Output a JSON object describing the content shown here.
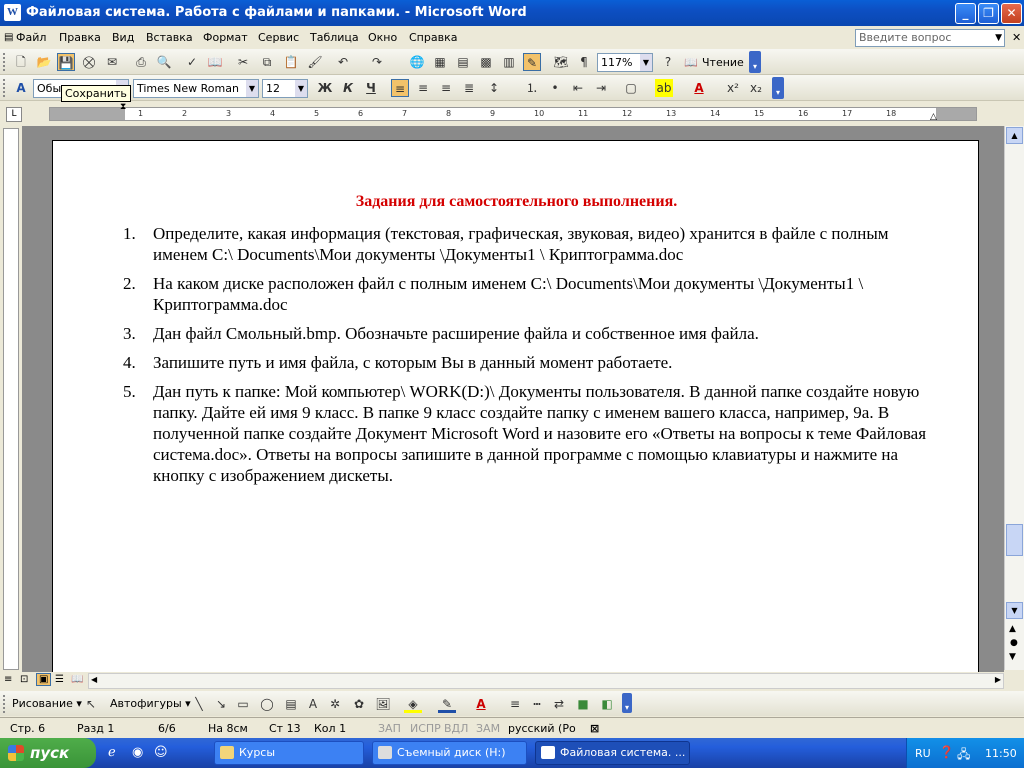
{
  "window": {
    "title": "Файловая система. Работа с файлами и папками. - Microsoft Word",
    "app_icon": "W"
  },
  "menu": {
    "items": [
      "Файл",
      "Правка",
      "Вид",
      "Вставка",
      "Формат",
      "Сервис",
      "Таблица",
      "Окно",
      "Справка"
    ],
    "ask_placeholder": "Введите вопрос"
  },
  "toolbar": {
    "zoom": "117%",
    "reading_label": "Чтение",
    "tooltip": "Сохранить"
  },
  "format": {
    "style": "Обыч",
    "font": "Times New Roman",
    "size": "12",
    "bold": "Ж",
    "italic": "К",
    "underline": "Ч"
  },
  "document": {
    "heading": "Задания для самостоятельного выполнения.",
    "items": [
      {
        "num": "1.",
        "text": "Определите, какая информация (текстовая, графическая, звуковая, видео) хранится в файле  с полным именем С:\\ Documents\\Мои документы \\Документы1 \\ Криптограмма.doc"
      },
      {
        "num": "2.",
        "text": "На каком диске расположен файл с полным именем  С:\\ Documents\\Мои документы \\Документы1 \\ Криптограмма.doc"
      },
      {
        "num": "3.",
        "text": "Дан файл Смольный.bmp. Обозначьте расширение файла и собственное имя файла."
      },
      {
        "num": "4.",
        "text": "Запишите путь и имя файла, с которым Вы в данный момент работаете."
      },
      {
        "num": "5.",
        "text": "Дан путь к папке: Мой компьютер\\ WORK(D:)\\ Документы пользователя. В данной папке создайте новую папку. Дайте ей имя 9 класс. В папке 9 класс создайте папку с именем вашего класса, например, 9а. В полученной папке создайте Документ Microsoft Word и назовите его «Ответы на вопросы к теме  Файловая система.doc». Ответы на вопросы запишите в данной программе с помощью клавиатуры и нажмите на кнопку с изображением дискеты."
      }
    ]
  },
  "drawing": {
    "draw_label": "Рисование",
    "autoshapes_label": "Автофигуры"
  },
  "status": {
    "page": "Стр. 6",
    "section": "Разд 1",
    "pages": "6/6",
    "at": "На 8см",
    "line": "Ст 13",
    "col": "Кол 1",
    "rec": "ЗАП",
    "trk": "ИСПР",
    "ext": "ВДЛ",
    "ovr": "ЗАМ",
    "lang": "русский (Ро"
  },
  "taskbar": {
    "start": "пуск",
    "tasks": [
      "Курсы",
      "Съемный диск (H:)",
      "Файловая система. ..."
    ],
    "lang": "RU",
    "clock": "11:50"
  },
  "ruler": {
    "ticks": [
      "1",
      "1",
      "2",
      "3",
      "4",
      "5",
      "6",
      "7",
      "8",
      "9",
      "10",
      "11",
      "12",
      "13",
      "14",
      "15",
      "16",
      "17",
      "18"
    ]
  }
}
